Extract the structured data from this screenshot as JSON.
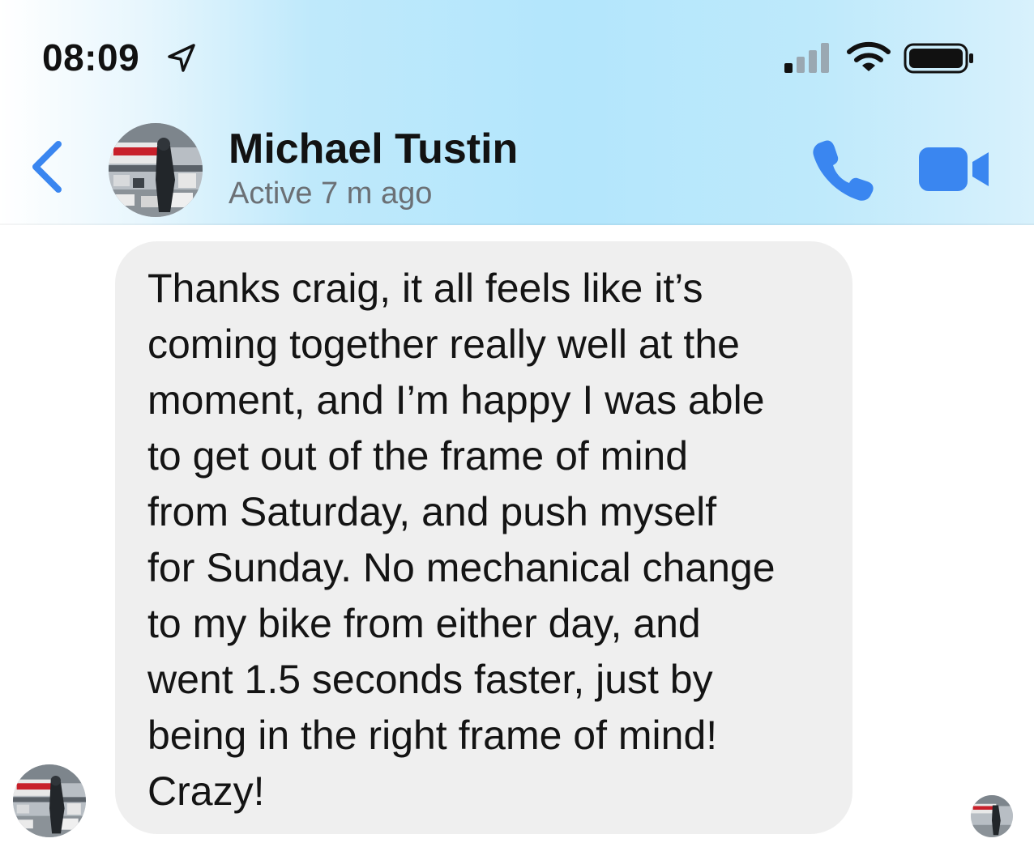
{
  "status_bar": {
    "time": "08:09",
    "location_icon": "location-arrow-icon",
    "signal_icon": "cellular-signal-icon",
    "wifi_icon": "wifi-icon",
    "battery_icon": "battery-icon"
  },
  "header": {
    "back_icon": "chevron-left-icon",
    "contact_name": "Michael Tustin",
    "contact_status": "Active 7 m ago",
    "call_icon": "phone-icon",
    "video_icon": "video-camera-icon",
    "accent_color": "#3a86f0"
  },
  "conversation": {
    "message": {
      "lines": [
        "Thanks craig, it all feels like it’s",
        "coming together really well at the",
        "moment, and I’m happy I was able",
        "to get out of the frame of mind",
        "from Saturday, and push myself",
        "for Sunday. No mechanical change",
        "to my bike from either day, and",
        "went 1.5 seconds faster, just by",
        "being in the right frame of mind!",
        "Crazy!"
      ],
      "bubble_color": "#efefef"
    }
  }
}
